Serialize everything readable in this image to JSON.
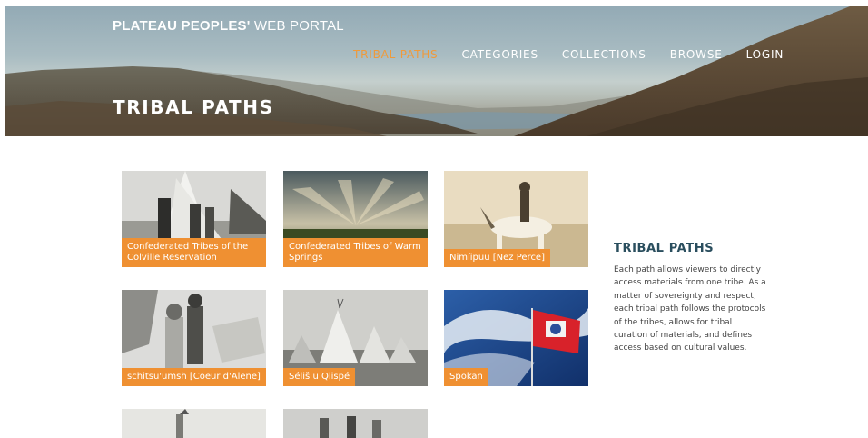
{
  "header": {
    "brand_bold": "PLATEAU PEOPLES'",
    "brand_light": " WEB PORTAL",
    "title": "TRIBAL PATHS",
    "nav": [
      {
        "label": "TRIBAL PATHS",
        "active": true
      },
      {
        "label": "CATEGORIES",
        "active": false
      },
      {
        "label": "COLLECTIONS",
        "active": false
      },
      {
        "label": "BROWSE",
        "active": false
      },
      {
        "label": "LOGIN",
        "active": false
      }
    ]
  },
  "tiles": [
    {
      "caption": "Confederated Tribes of the Colville Reservation"
    },
    {
      "caption": "Confederated Tribes of Warm Springs"
    },
    {
      "caption": "Nimíipuu [Nez Perce]"
    },
    {
      "caption": "schitsu'umsh [Coeur d'Alene]"
    },
    {
      "caption": "Séliš u Qlispé"
    },
    {
      "caption": "Spokan"
    }
  ],
  "sidebar": {
    "title": "TRIBAL PATHS",
    "text": "Each path allows viewers to directly access materials from one tribe. As a matter of sovereignty and respect, each tribal path follows the protocols of the tribes, allows for tribal curation of materials, and defines access based on cultural values."
  },
  "colors": {
    "accent": "#ef9032",
    "nav_active": "#ef9a3b",
    "heading": "#2a4e5e"
  }
}
